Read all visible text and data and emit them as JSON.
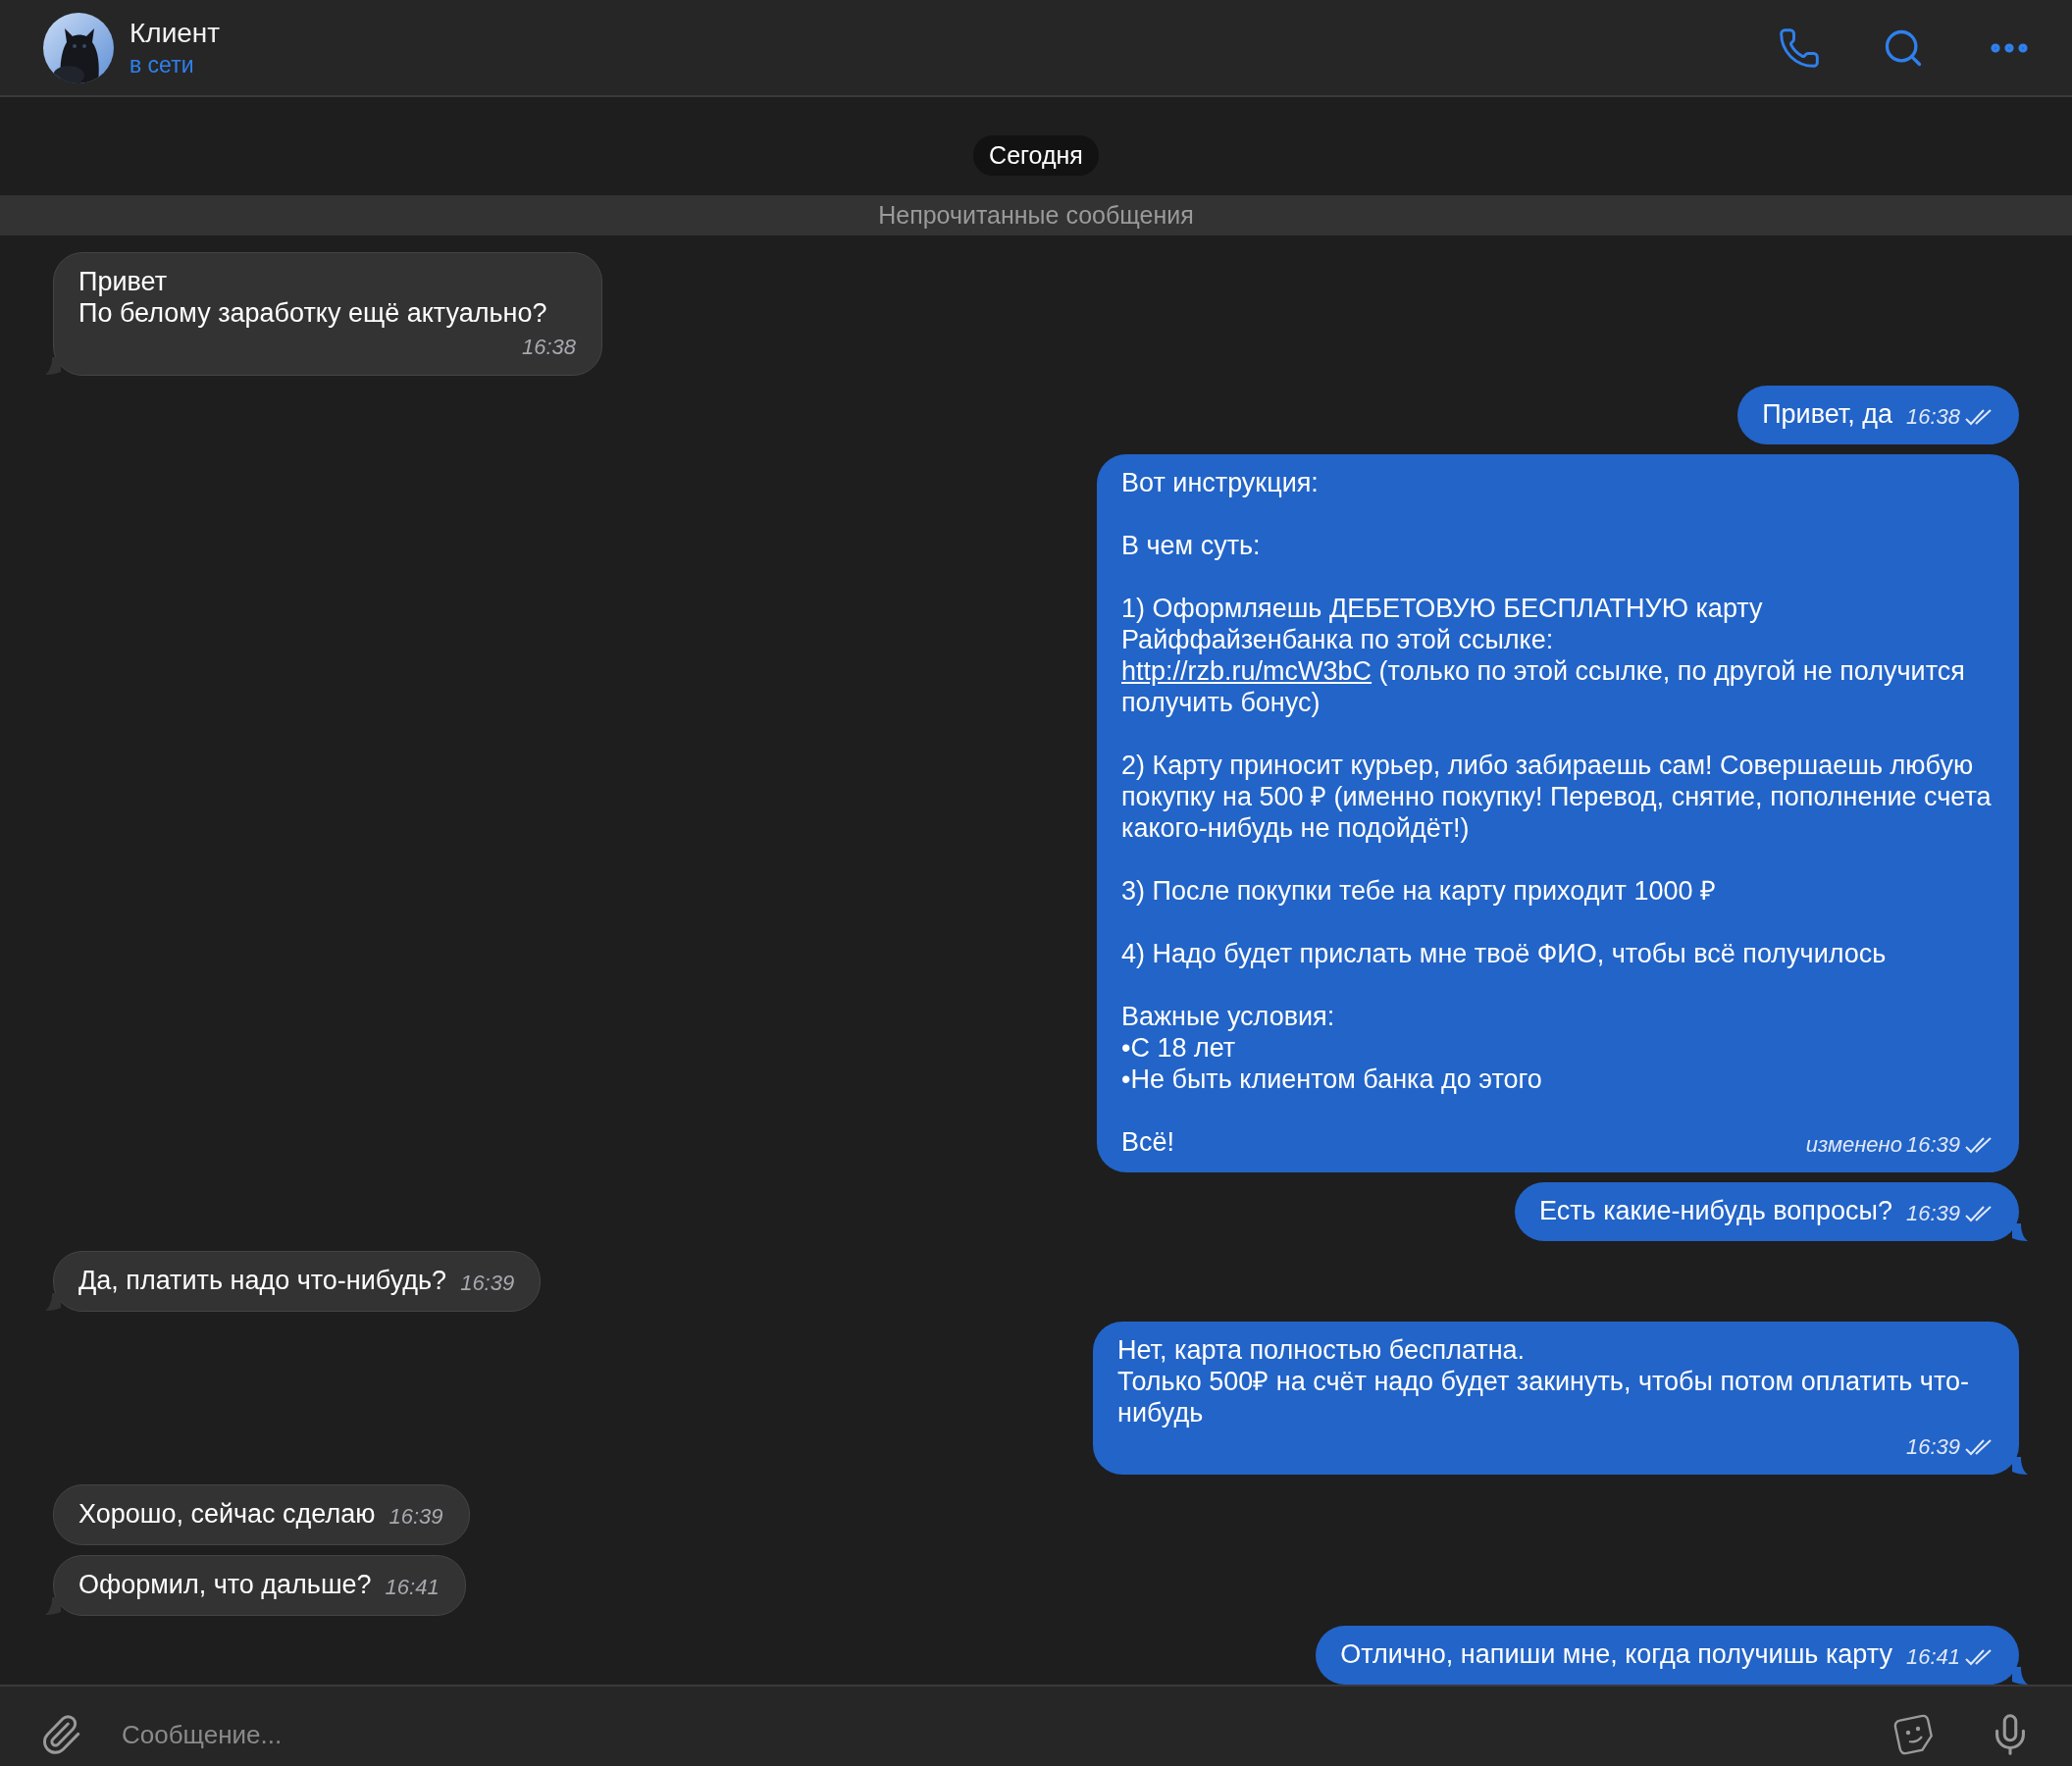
{
  "header": {
    "name": "Клиент",
    "status": "в сети"
  },
  "date_pill": "Сегодня",
  "unread_divider": "Непрочитанные сообщения",
  "messages": [
    {
      "kind": "text",
      "outgoing": false,
      "text": "Привет\nПо белому заработку ещё актуально?",
      "time": "16:38",
      "tail": true
    },
    {
      "kind": "text",
      "outgoing": true,
      "text": "Привет, да",
      "time": "16:38",
      "read": true,
      "tail": false
    },
    {
      "kind": "rich",
      "outgoing": true,
      "paragraphs": [
        {
          "text": "Вот инструкция:"
        },
        {
          "text": "В чем суть:"
        },
        {
          "text": "1) Оформляешь ДЕБЕТОВУЮ БЕСПЛАТНУЮ карту Райффайзенбанка по этой ссылке:",
          "link": "http://rzb.ru/mcW3bC",
          "after": "(только по этой ссылке, по другой не получится получить бонус)"
        },
        {
          "text": "2) Карту приносит курьер, либо забираешь сам! Совершаешь любую покупку на 500 ₽ (именно покупку! Перевод, снятие, пополнение счета какого-нибудь не подойдёт!)"
        },
        {
          "text": "3) После покупки тебе на карту приходит 1000 ₽"
        },
        {
          "text": "4) Надо будет прислать мне твоё ФИО, чтобы всё получилось"
        },
        {
          "text": "Важные условия:\n•С 18 лет\n•Не быть клиентом банка до этого"
        },
        {
          "text": "Всё!"
        }
      ],
      "edited": "изменено",
      "time": "16:39",
      "read": true,
      "tail": false
    },
    {
      "kind": "text",
      "outgoing": true,
      "text": "Есть какие-нибудь вопросы?",
      "time": "16:39",
      "read": true,
      "tail": true
    },
    {
      "kind": "text",
      "outgoing": false,
      "text": "Да, платить надо что-нибудь?",
      "time": "16:39",
      "tail": true
    },
    {
      "kind": "text",
      "outgoing": true,
      "text": "Нет, карта полностью бесплатна.\nТолько 500₽ на счёт надо будет закинуть, чтобы потом оплатить что-нибудь",
      "time": "16:39",
      "read": true,
      "tail": true
    },
    {
      "kind": "text",
      "outgoing": false,
      "text": "Хорошо, сейчас сделаю",
      "time": "16:39",
      "tail": false
    },
    {
      "kind": "text",
      "outgoing": false,
      "text": "Оформил, что дальше?",
      "time": "16:41",
      "tail": true
    },
    {
      "kind": "text",
      "outgoing": true,
      "text": "Отлично, напиши мне, когда получишь карту",
      "time": "16:41",
      "read": true,
      "tail": true
    }
  ],
  "composer": {
    "placeholder": "Сообщение..."
  }
}
